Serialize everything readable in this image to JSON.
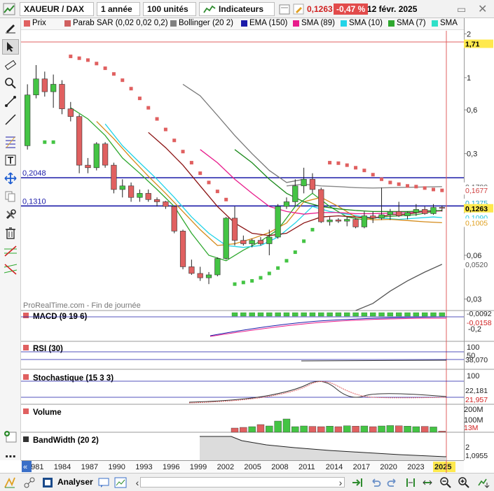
{
  "toolbar": {
    "symbol": "XAUEUR / DAX",
    "period": "1 année",
    "units": "100 unités",
    "indicators_label": "Indicateurs",
    "price": "0,1263",
    "change": "-0,47 %",
    "date": "12 févr. 2025",
    "change_color": "#e24b4b"
  },
  "legend": {
    "items": [
      {
        "label": "Prix",
        "color": "#e06060"
      },
      {
        "label": "Parab SAR (0,02 0,02 0,2)",
        "color": "#d06060"
      },
      {
        "label": "Bollinger (20 2)",
        "color": "#808080"
      },
      {
        "label": "EMA (150)",
        "color": "#1a1aa8"
      },
      {
        "label": "SMA (89)",
        "color": "#e81c8c"
      },
      {
        "label": "SMA (10)",
        "color": "#22d4e8"
      },
      {
        "label": "SMA (7)",
        "color": "#2ea82e"
      },
      {
        "label": "SMA",
        "color": "#2fe0c8"
      }
    ]
  },
  "tools": {
    "left_icons": [
      "pencil-icon",
      "cursor-icon",
      "ruler-icon",
      "zoom-icon",
      "segment-icon",
      "line-icon",
      "fibonacci-icon",
      "text-icon",
      "move-icon",
      "copy-icon",
      "wrench-icon",
      "trash-icon",
      "trend-up-icon",
      "trend-down-icon"
    ]
  },
  "watermark": "ProRealTime.com - Fin de journée",
  "panels": {
    "macd": {
      "label": "MACD (9 19 6)",
      "ticks": [
        "0,2",
        "-0,2"
      ],
      "tags": [
        "-0,0092",
        "-0,0158"
      ]
    },
    "rsi": {
      "label": "RSI (30)",
      "ticks": [
        "100",
        "50"
      ],
      "tags": [
        "38,070"
      ]
    },
    "stoch": {
      "label": "Stochastique (15 3 3)",
      "ticks": [
        "100"
      ],
      "tags": [
        "22,181",
        "21,957"
      ]
    },
    "volume": {
      "label": "Volume",
      "ticks": [
        "200M",
        "100M"
      ],
      "tags": [
        "13M"
      ]
    },
    "bandwidth": {
      "label": "BandWidth (20 2)",
      "ticks": [
        "2"
      ],
      "tags": [
        "1,0955"
      ]
    }
  },
  "bottom": {
    "analyser_label": "Analyser"
  },
  "chart_data": {
    "type": "candlestick",
    "scale": "log",
    "x_labels": [
      "1981",
      "1984",
      "1987",
      "1990",
      "1993",
      "1996",
      "1999",
      "2002",
      "2005",
      "2008",
      "2011",
      "2014",
      "2017",
      "2020",
      "2023",
      "2025"
    ],
    "y_ticks": [
      2,
      1,
      0.6,
      0.3,
      0.1,
      0.06,
      0.03
    ],
    "y_tick_labels": [
      "2",
      "1",
      "0,6",
      "0,3",
      "0,1",
      "0,06",
      "0,03"
    ],
    "ylim": [
      0.025,
      2.1
    ],
    "horizontal_lines": [
      {
        "value": 0.2048,
        "label": "0,2048",
        "color": "#1a1aa8"
      },
      {
        "value": 0.131,
        "label": "0,1310",
        "color": "#1a1aa8"
      }
    ],
    "price_tags": [
      {
        "value": 1.71,
        "label": "1,71",
        "bg": "#ffe94d",
        "fg": "#000000"
      },
      {
        "value": 0.178,
        "label": "0,1780",
        "bg": "#ffffff",
        "fg": "#555555"
      },
      {
        "value": 0.1677,
        "label": "0,1677",
        "bg": "#ffffff",
        "fg": "#d04040"
      },
      {
        "value": 0.1375,
        "label": "0,1375",
        "bg": "#ffffff",
        "fg": "#22a8c8"
      },
      {
        "value": 0.1263,
        "label": "0,1263",
        "bg": "#ffe94d",
        "fg": "#000000"
      },
      {
        "value": 0.109,
        "label": "0,1090",
        "bg": "#ffffff",
        "fg": "#22c8e0"
      },
      {
        "value": 0.1005,
        "label": "0,1005",
        "bg": "#ffffff",
        "fg": "#e0a020"
      },
      {
        "value": 0.052,
        "label": "0,0520",
        "bg": "#ffffff",
        "fg": "#555555"
      }
    ],
    "candles": [
      {
        "o": 0.34,
        "h": 0.9,
        "l": 0.32,
        "c": 0.76
      },
      {
        "o": 0.76,
        "h": 1.22,
        "l": 0.72,
        "c": 0.98
      },
      {
        "o": 0.98,
        "h": 1.1,
        "l": 0.74,
        "c": 0.8
      },
      {
        "o": 0.8,
        "h": 1.05,
        "l": 0.62,
        "c": 0.9
      },
      {
        "o": 0.9,
        "h": 0.96,
        "l": 0.56,
        "c": 0.61
      },
      {
        "o": 0.61,
        "h": 0.68,
        "l": 0.5,
        "c": 0.54
      },
      {
        "o": 0.54,
        "h": 0.56,
        "l": 0.22,
        "c": 0.25
      },
      {
        "o": 0.25,
        "h": 0.28,
        "l": 0.22,
        "c": 0.24
      },
      {
        "o": 0.24,
        "h": 0.36,
        "l": 0.23,
        "c": 0.35
      },
      {
        "o": 0.35,
        "h": 0.36,
        "l": 0.24,
        "c": 0.25
      },
      {
        "o": 0.25,
        "h": 0.26,
        "l": 0.16,
        "c": 0.17
      },
      {
        "o": 0.17,
        "h": 0.2,
        "l": 0.15,
        "c": 0.18
      },
      {
        "o": 0.18,
        "h": 0.19,
        "l": 0.14,
        "c": 0.15
      },
      {
        "o": 0.15,
        "h": 0.17,
        "l": 0.14,
        "c": 0.16
      },
      {
        "o": 0.16,
        "h": 0.17,
        "l": 0.14,
        "c": 0.145
      },
      {
        "o": 0.145,
        "h": 0.15,
        "l": 0.13,
        "c": 0.14
      },
      {
        "o": 0.14,
        "h": 0.142,
        "l": 0.125,
        "c": 0.13
      },
      {
        "o": 0.13,
        "h": 0.132,
        "l": 0.085,
        "c": 0.088
      },
      {
        "o": 0.088,
        "h": 0.09,
        "l": 0.048,
        "c": 0.05
      },
      {
        "o": 0.05,
        "h": 0.056,
        "l": 0.044,
        "c": 0.045
      },
      {
        "o": 0.045,
        "h": 0.05,
        "l": 0.04,
        "c": 0.042
      },
      {
        "o": 0.042,
        "h": 0.046,
        "l": 0.038,
        "c": 0.044
      },
      {
        "o": 0.044,
        "h": 0.058,
        "l": 0.043,
        "c": 0.057
      },
      {
        "o": 0.057,
        "h": 0.11,
        "l": 0.056,
        "c": 0.108
      },
      {
        "o": 0.108,
        "h": 0.13,
        "l": 0.07,
        "c": 0.076
      },
      {
        "o": 0.076,
        "h": 0.082,
        "l": 0.07,
        "c": 0.072
      },
      {
        "o": 0.072,
        "h": 0.078,
        "l": 0.068,
        "c": 0.076
      },
      {
        "o": 0.076,
        "h": 0.08,
        "l": 0.07,
        "c": 0.072
      },
      {
        "o": 0.072,
        "h": 0.09,
        "l": 0.06,
        "c": 0.08
      },
      {
        "o": 0.08,
        "h": 0.135,
        "l": 0.078,
        "c": 0.13
      },
      {
        "o": 0.13,
        "h": 0.15,
        "l": 0.125,
        "c": 0.14
      },
      {
        "o": 0.14,
        "h": 0.2,
        "l": 0.13,
        "c": 0.18
      },
      {
        "o": 0.18,
        "h": 0.24,
        "l": 0.16,
        "c": 0.2
      },
      {
        "o": 0.2,
        "h": 0.22,
        "l": 0.16,
        "c": 0.17
      },
      {
        "o": 0.17,
        "h": 0.175,
        "l": 0.1,
        "c": 0.102
      },
      {
        "o": 0.102,
        "h": 0.11,
        "l": 0.096,
        "c": 0.105
      },
      {
        "o": 0.105,
        "h": 0.108,
        "l": 0.1,
        "c": 0.103
      },
      {
        "o": 0.103,
        "h": 0.11,
        "l": 0.095,
        "c": 0.106
      },
      {
        "o": 0.106,
        "h": 0.108,
        "l": 0.092,
        "c": 0.094
      },
      {
        "o": 0.094,
        "h": 0.12,
        "l": 0.092,
        "c": 0.112
      },
      {
        "o": 0.112,
        "h": 0.12,
        "l": 0.1,
        "c": 0.108
      },
      {
        "o": 0.108,
        "h": 0.175,
        "l": 0.105,
        "c": 0.114
      },
      {
        "o": 0.114,
        "h": 0.125,
        "l": 0.105,
        "c": 0.12
      },
      {
        "o": 0.12,
        "h": 0.14,
        "l": 0.11,
        "c": 0.112
      },
      {
        "o": 0.112,
        "h": 0.12,
        "l": 0.106,
        "c": 0.118
      },
      {
        "o": 0.118,
        "h": 0.135,
        "l": 0.112,
        "c": 0.124
      },
      {
        "o": 0.124,
        "h": 0.13,
        "l": 0.114,
        "c": 0.116
      },
      {
        "o": 0.116,
        "h": 0.135,
        "l": 0.114,
        "c": 0.128
      },
      {
        "o": 0.128,
        "h": 0.132,
        "l": 0.12,
        "c": 0.1263
      }
    ],
    "sar_points": [
      {
        "i": 2,
        "v": 0.36
      },
      {
        "i": 3,
        "v": 0.36
      },
      {
        "i": 5,
        "v": 1.4
      },
      {
        "i": 6,
        "v": 1.36
      },
      {
        "i": 7,
        "v": 1.32
      },
      {
        "i": 8,
        "v": 1.25
      },
      {
        "i": 9,
        "v": 1.16
      },
      {
        "i": 10,
        "v": 1.06
      },
      {
        "i": 11,
        "v": 0.96
      },
      {
        "i": 12,
        "v": 0.84
      },
      {
        "i": 13,
        "v": 0.72
      },
      {
        "i": 14,
        "v": 0.62
      },
      {
        "i": 15,
        "v": 0.52
      },
      {
        "i": 16,
        "v": 0.44
      },
      {
        "i": 17,
        "v": 0.37
      },
      {
        "i": 18,
        "v": 0.31
      },
      {
        "i": 19,
        "v": 0.26
      },
      {
        "i": 20,
        "v": 0.22
      },
      {
        "i": 21,
        "v": 0.19
      },
      {
        "i": 22,
        "v": 0.165
      },
      {
        "i": 23,
        "v": 0.145
      },
      {
        "i": 24,
        "v": 0.038
      },
      {
        "i": 25,
        "v": 0.039
      },
      {
        "i": 26,
        "v": 0.04
      },
      {
        "i": 27,
        "v": 0.042
      },
      {
        "i": 28,
        "v": 0.045
      },
      {
        "i": 29,
        "v": 0.049
      },
      {
        "i": 30,
        "v": 0.055
      },
      {
        "i": 31,
        "v": 0.063
      },
      {
        "i": 32,
        "v": 0.075
      },
      {
        "i": 33,
        "v": 0.09
      },
      {
        "i": 35,
        "v": 0.26
      },
      {
        "i": 36,
        "v": 0.258
      },
      {
        "i": 37,
        "v": 0.25
      },
      {
        "i": 38,
        "v": 0.24
      },
      {
        "i": 39,
        "v": 0.23
      },
      {
        "i": 40,
        "v": 0.215
      },
      {
        "i": 41,
        "v": 0.2
      },
      {
        "i": 42,
        "v": 0.19
      },
      {
        "i": 43,
        "v": 0.185
      },
      {
        "i": 44,
        "v": 0.18
      },
      {
        "i": 45,
        "v": 0.178
      },
      {
        "i": 46,
        "v": 0.174
      },
      {
        "i": 47,
        "v": 0.17
      },
      {
        "i": 48,
        "v": 0.1677
      }
    ],
    "lines": [
      {
        "name": "SMA (7)",
        "color": "#2ea82e",
        "points": [
          [
            5,
            0.62
          ],
          [
            7,
            0.52
          ],
          [
            9,
            0.4
          ],
          [
            11,
            0.28
          ],
          [
            13,
            0.22
          ],
          [
            15,
            0.17
          ],
          [
            17,
            0.13
          ],
          [
            19,
            0.085
          ],
          [
            21,
            0.06
          ],
          [
            23,
            0.055
          ],
          [
            25,
            0.065
          ],
          [
            27,
            0.075
          ],
          [
            29,
            0.09
          ],
          [
            31,
            0.13
          ],
          [
            33,
            0.16
          ],
          [
            35,
            0.13
          ],
          [
            37,
            0.11
          ],
          [
            39,
            0.105
          ],
          [
            41,
            0.11
          ],
          [
            43,
            0.112
          ],
          [
            45,
            0.114
          ],
          [
            47,
            0.12
          ],
          [
            48,
            0.122
          ]
        ]
      },
      {
        "name": "SMA (10)",
        "color": "#22d4e8",
        "points": [
          [
            9,
            0.48
          ],
          [
            11,
            0.34
          ],
          [
            13,
            0.26
          ],
          [
            15,
            0.2
          ],
          [
            17,
            0.15
          ],
          [
            19,
            0.11
          ],
          [
            21,
            0.085
          ],
          [
            23,
            0.07
          ],
          [
            25,
            0.068
          ],
          [
            27,
            0.07
          ],
          [
            29,
            0.08
          ],
          [
            31,
            0.1
          ],
          [
            33,
            0.13
          ],
          [
            35,
            0.12
          ],
          [
            37,
            0.115
          ],
          [
            39,
            0.11
          ],
          [
            41,
            0.108
          ],
          [
            43,
            0.106
          ],
          [
            45,
            0.108
          ],
          [
            47,
            0.11
          ],
          [
            48,
            0.109
          ]
        ]
      },
      {
        "name": "SMA orange",
        "color": "#d48a1a",
        "points": [
          [
            8,
            0.5
          ],
          [
            10,
            0.38
          ],
          [
            12,
            0.28
          ],
          [
            14,
            0.21
          ],
          [
            16,
            0.16
          ],
          [
            18,
            0.12
          ],
          [
            20,
            0.09
          ],
          [
            22,
            0.07
          ],
          [
            24,
            0.072
          ],
          [
            26,
            0.078
          ],
          [
            28,
            0.086
          ],
          [
            30,
            0.1
          ],
          [
            32,
            0.14
          ],
          [
            34,
            0.15
          ],
          [
            36,
            0.13
          ],
          [
            38,
            0.11
          ],
          [
            40,
            0.105
          ],
          [
            42,
            0.106
          ],
          [
            44,
            0.104
          ],
          [
            46,
            0.102
          ],
          [
            48,
            0.1005
          ]
        ]
      },
      {
        "name": "SMA dark red",
        "color": "#8a1010",
        "points": [
          [
            14,
            0.42
          ],
          [
            16,
            0.33
          ],
          [
            18,
            0.25
          ],
          [
            20,
            0.18
          ],
          [
            22,
            0.13
          ],
          [
            24,
            0.1
          ],
          [
            26,
            0.085
          ],
          [
            28,
            0.082
          ],
          [
            30,
            0.085
          ],
          [
            32,
            0.1
          ],
          [
            34,
            0.11
          ],
          [
            36,
            0.112
          ],
          [
            38,
            0.11
          ],
          [
            40,
            0.108
          ],
          [
            42,
            0.114
          ],
          [
            44,
            0.115
          ],
          [
            46,
            0.12
          ],
          [
            48,
            0.122
          ]
        ]
      },
      {
        "name": "SMA (89)",
        "color": "#e81c8c",
        "points": [
          [
            20,
            0.32
          ],
          [
            22,
            0.26
          ],
          [
            24,
            0.2
          ],
          [
            26,
            0.16
          ],
          [
            28,
            0.13
          ],
          [
            30,
            0.12
          ],
          [
            32,
            0.115
          ],
          [
            34,
            0.118
          ],
          [
            36,
            0.118
          ],
          [
            38,
            0.116
          ],
          [
            40,
            0.116
          ],
          [
            42,
            0.117
          ],
          [
            44,
            0.118
          ],
          [
            46,
            0.12
          ],
          [
            48,
            0.121
          ]
        ]
      },
      {
        "name": "SMA green",
        "color": "#1c8a1c",
        "points": [
          [
            24,
            0.32
          ],
          [
            26,
            0.26
          ],
          [
            28,
            0.2
          ],
          [
            30,
            0.16
          ],
          [
            32,
            0.14
          ],
          [
            34,
            0.13
          ],
          [
            36,
            0.125
          ],
          [
            38,
            0.122
          ],
          [
            40,
            0.12
          ],
          [
            42,
            0.12
          ],
          [
            44,
            0.12
          ],
          [
            46,
            0.121
          ],
          [
            48,
            0.122
          ]
        ]
      },
      {
        "name": "Bollinger mid",
        "color": "#888888",
        "points": [
          [
            30,
            0.18
          ],
          [
            32,
            0.185
          ],
          [
            34,
            0.18
          ],
          [
            36,
            0.178
          ],
          [
            38,
            0.175
          ],
          [
            40,
            0.174
          ],
          [
            42,
            0.175
          ],
          [
            44,
            0.176
          ],
          [
            46,
            0.177
          ],
          [
            48,
            0.178
          ]
        ]
      },
      {
        "name": "Bollinger upper",
        "color": "#777777",
        "points": [
          [
            18,
            0.9
          ],
          [
            20,
            0.75
          ],
          [
            22,
            0.55
          ],
          [
            24,
            0.4
          ],
          [
            26,
            0.3
          ],
          [
            28,
            0.23
          ],
          [
            30,
            0.19
          ],
          [
            32,
            0.2
          ]
        ]
      },
      {
        "name": "Bollinger lower",
        "color": "#555555",
        "points": [
          [
            38,
            0.025
          ],
          [
            40,
            0.028
          ],
          [
            42,
            0.034
          ],
          [
            44,
            0.04
          ],
          [
            46,
            0.046
          ],
          [
            48,
            0.052
          ]
        ]
      }
    ]
  }
}
